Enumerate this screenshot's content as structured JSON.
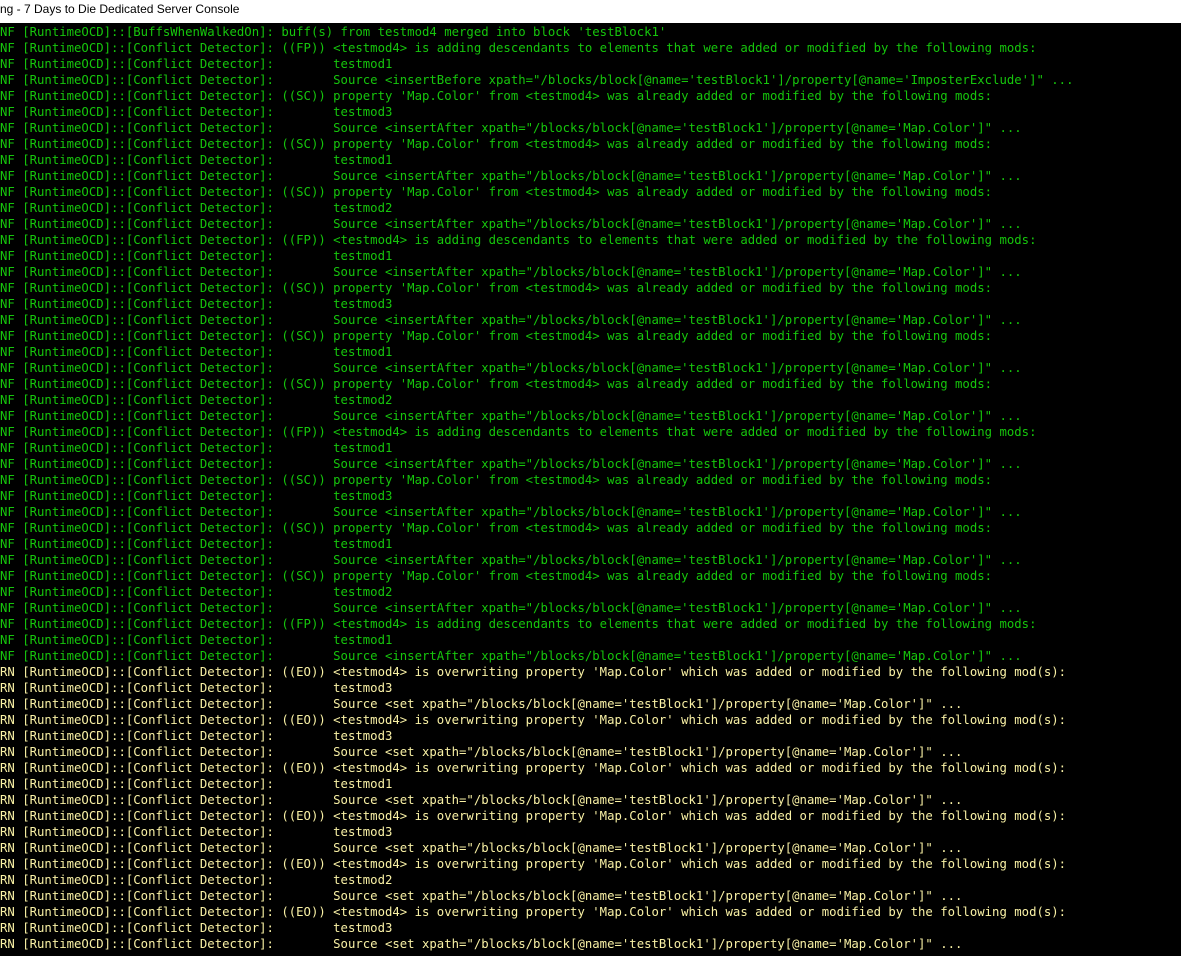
{
  "window": {
    "title": "ng - 7 Days to Die Dedicated Server Console"
  },
  "colors": {
    "info": "#16c60c",
    "warning": "#f9f1a5",
    "background": "#000000",
    "titlebar": "#ffffff"
  },
  "console": {
    "lines": [
      {
        "level": "NF",
        "text": "NF [RuntimeOCD]::[BuffsWhenWalkedOn]: buff(s) from testmod4 merged into block 'testBlock1'"
      },
      {
        "level": "NF",
        "text": "NF [RuntimeOCD]::[Conflict Detector]: ((FP)) <testmod4> is adding descendants to elements that were added or modified by the following mods:"
      },
      {
        "level": "NF",
        "text": "NF [RuntimeOCD]::[Conflict Detector]:        testmod1"
      },
      {
        "level": "NF",
        "text": "NF [RuntimeOCD]::[Conflict Detector]:        Source <insertBefore xpath=\"/blocks/block[@name='testBlock1']/property[@name='ImposterExclude']\" ..."
      },
      {
        "level": "NF",
        "text": "NF [RuntimeOCD]::[Conflict Detector]: ((SC)) property 'Map.Color' from <testmod4> was already added or modified by the following mods:"
      },
      {
        "level": "NF",
        "text": "NF [RuntimeOCD]::[Conflict Detector]:        testmod3"
      },
      {
        "level": "NF",
        "text": "NF [RuntimeOCD]::[Conflict Detector]:        Source <insertAfter xpath=\"/blocks/block[@name='testBlock1']/property[@name='Map.Color']\" ..."
      },
      {
        "level": "NF",
        "text": "NF [RuntimeOCD]::[Conflict Detector]: ((SC)) property 'Map.Color' from <testmod4> was already added or modified by the following mods:"
      },
      {
        "level": "NF",
        "text": "NF [RuntimeOCD]::[Conflict Detector]:        testmod1"
      },
      {
        "level": "NF",
        "text": "NF [RuntimeOCD]::[Conflict Detector]:        Source <insertAfter xpath=\"/blocks/block[@name='testBlock1']/property[@name='Map.Color']\" ..."
      },
      {
        "level": "NF",
        "text": "NF [RuntimeOCD]::[Conflict Detector]: ((SC)) property 'Map.Color' from <testmod4> was already added or modified by the following mods:"
      },
      {
        "level": "NF",
        "text": "NF [RuntimeOCD]::[Conflict Detector]:        testmod2"
      },
      {
        "level": "NF",
        "text": "NF [RuntimeOCD]::[Conflict Detector]:        Source <insertAfter xpath=\"/blocks/block[@name='testBlock1']/property[@name='Map.Color']\" ..."
      },
      {
        "level": "NF",
        "text": "NF [RuntimeOCD]::[Conflict Detector]: ((FP)) <testmod4> is adding descendants to elements that were added or modified by the following mods:"
      },
      {
        "level": "NF",
        "text": "NF [RuntimeOCD]::[Conflict Detector]:        testmod1"
      },
      {
        "level": "NF",
        "text": "NF [RuntimeOCD]::[Conflict Detector]:        Source <insertAfter xpath=\"/blocks/block[@name='testBlock1']/property[@name='Map.Color']\" ..."
      },
      {
        "level": "NF",
        "text": "NF [RuntimeOCD]::[Conflict Detector]: ((SC)) property 'Map.Color' from <testmod4> was already added or modified by the following mods:"
      },
      {
        "level": "NF",
        "text": "NF [RuntimeOCD]::[Conflict Detector]:        testmod3"
      },
      {
        "level": "NF",
        "text": "NF [RuntimeOCD]::[Conflict Detector]:        Source <insertAfter xpath=\"/blocks/block[@name='testBlock1']/property[@name='Map.Color']\" ..."
      },
      {
        "level": "NF",
        "text": "NF [RuntimeOCD]::[Conflict Detector]: ((SC)) property 'Map.Color' from <testmod4> was already added or modified by the following mods:"
      },
      {
        "level": "NF",
        "text": "NF [RuntimeOCD]::[Conflict Detector]:        testmod1"
      },
      {
        "level": "NF",
        "text": "NF [RuntimeOCD]::[Conflict Detector]:        Source <insertAfter xpath=\"/blocks/block[@name='testBlock1']/property[@name='Map.Color']\" ..."
      },
      {
        "level": "NF",
        "text": "NF [RuntimeOCD]::[Conflict Detector]: ((SC)) property 'Map.Color' from <testmod4> was already added or modified by the following mods:"
      },
      {
        "level": "NF",
        "text": "NF [RuntimeOCD]::[Conflict Detector]:        testmod2"
      },
      {
        "level": "NF",
        "text": "NF [RuntimeOCD]::[Conflict Detector]:        Source <insertAfter xpath=\"/blocks/block[@name='testBlock1']/property[@name='Map.Color']\" ..."
      },
      {
        "level": "NF",
        "text": "NF [RuntimeOCD]::[Conflict Detector]: ((FP)) <testmod4> is adding descendants to elements that were added or modified by the following mods:"
      },
      {
        "level": "NF",
        "text": "NF [RuntimeOCD]::[Conflict Detector]:        testmod1"
      },
      {
        "level": "NF",
        "text": "NF [RuntimeOCD]::[Conflict Detector]:        Source <insertAfter xpath=\"/blocks/block[@name='testBlock1']/property[@name='Map.Color']\" ..."
      },
      {
        "level": "NF",
        "text": "NF [RuntimeOCD]::[Conflict Detector]: ((SC)) property 'Map.Color' from <testmod4> was already added or modified by the following mods:"
      },
      {
        "level": "NF",
        "text": "NF [RuntimeOCD]::[Conflict Detector]:        testmod3"
      },
      {
        "level": "NF",
        "text": "NF [RuntimeOCD]::[Conflict Detector]:        Source <insertAfter xpath=\"/blocks/block[@name='testBlock1']/property[@name='Map.Color']\" ..."
      },
      {
        "level": "NF",
        "text": "NF [RuntimeOCD]::[Conflict Detector]: ((SC)) property 'Map.Color' from <testmod4> was already added or modified by the following mods:"
      },
      {
        "level": "NF",
        "text": "NF [RuntimeOCD]::[Conflict Detector]:        testmod1"
      },
      {
        "level": "NF",
        "text": "NF [RuntimeOCD]::[Conflict Detector]:        Source <insertAfter xpath=\"/blocks/block[@name='testBlock1']/property[@name='Map.Color']\" ..."
      },
      {
        "level": "NF",
        "text": "NF [RuntimeOCD]::[Conflict Detector]: ((SC)) property 'Map.Color' from <testmod4> was already added or modified by the following mods:"
      },
      {
        "level": "NF",
        "text": "NF [RuntimeOCD]::[Conflict Detector]:        testmod2"
      },
      {
        "level": "NF",
        "text": "NF [RuntimeOCD]::[Conflict Detector]:        Source <insertAfter xpath=\"/blocks/block[@name='testBlock1']/property[@name='Map.Color']\" ..."
      },
      {
        "level": "NF",
        "text": "NF [RuntimeOCD]::[Conflict Detector]: ((FP)) <testmod4> is adding descendants to elements that were added or modified by the following mods:"
      },
      {
        "level": "NF",
        "text": "NF [RuntimeOCD]::[Conflict Detector]:        testmod1"
      },
      {
        "level": "NF",
        "text": "NF [RuntimeOCD]::[Conflict Detector]:        Source <insertAfter xpath=\"/blocks/block[@name='testBlock1']/property[@name='Map.Color']\" ..."
      },
      {
        "level": "RN",
        "text": "RN [RuntimeOCD]::[Conflict Detector]: ((EO)) <testmod4> is overwriting property 'Map.Color' which was added or modified by the following mod(s):"
      },
      {
        "level": "RN",
        "text": "RN [RuntimeOCD]::[Conflict Detector]:        testmod3"
      },
      {
        "level": "RN",
        "text": "RN [RuntimeOCD]::[Conflict Detector]:        Source <set xpath=\"/blocks/block[@name='testBlock1']/property[@name='Map.Color']\" ..."
      },
      {
        "level": "RN",
        "text": "RN [RuntimeOCD]::[Conflict Detector]: ((EO)) <testmod4> is overwriting property 'Map.Color' which was added or modified by the following mod(s):"
      },
      {
        "level": "RN",
        "text": "RN [RuntimeOCD]::[Conflict Detector]:        testmod3"
      },
      {
        "level": "RN",
        "text": "RN [RuntimeOCD]::[Conflict Detector]:        Source <set xpath=\"/blocks/block[@name='testBlock1']/property[@name='Map.Color']\" ..."
      },
      {
        "level": "RN",
        "text": "RN [RuntimeOCD]::[Conflict Detector]: ((EO)) <testmod4> is overwriting property 'Map.Color' which was added or modified by the following mod(s):"
      },
      {
        "level": "RN",
        "text": "RN [RuntimeOCD]::[Conflict Detector]:        testmod1"
      },
      {
        "level": "RN",
        "text": "RN [RuntimeOCD]::[Conflict Detector]:        Source <set xpath=\"/blocks/block[@name='testBlock1']/property[@name='Map.Color']\" ..."
      },
      {
        "level": "RN",
        "text": "RN [RuntimeOCD]::[Conflict Detector]: ((EO)) <testmod4> is overwriting property 'Map.Color' which was added or modified by the following mod(s):"
      },
      {
        "level": "RN",
        "text": "RN [RuntimeOCD]::[Conflict Detector]:        testmod3"
      },
      {
        "level": "RN",
        "text": "RN [RuntimeOCD]::[Conflict Detector]:        Source <set xpath=\"/blocks/block[@name='testBlock1']/property[@name='Map.Color']\" ..."
      },
      {
        "level": "RN",
        "text": "RN [RuntimeOCD]::[Conflict Detector]: ((EO)) <testmod4> is overwriting property 'Map.Color' which was added or modified by the following mod(s):"
      },
      {
        "level": "RN",
        "text": "RN [RuntimeOCD]::[Conflict Detector]:        testmod2"
      },
      {
        "level": "RN",
        "text": "RN [RuntimeOCD]::[Conflict Detector]:        Source <set xpath=\"/blocks/block[@name='testBlock1']/property[@name='Map.Color']\" ..."
      },
      {
        "level": "RN",
        "text": "RN [RuntimeOCD]::[Conflict Detector]: ((EO)) <testmod4> is overwriting property 'Map.Color' which was added or modified by the following mod(s):"
      },
      {
        "level": "RN",
        "text": "RN [RuntimeOCD]::[Conflict Detector]:        testmod3"
      },
      {
        "level": "RN",
        "text": "RN [RuntimeOCD]::[Conflict Detector]:        Source <set xpath=\"/blocks/block[@name='testBlock1']/property[@name='Map.Color']\" ..."
      }
    ]
  }
}
